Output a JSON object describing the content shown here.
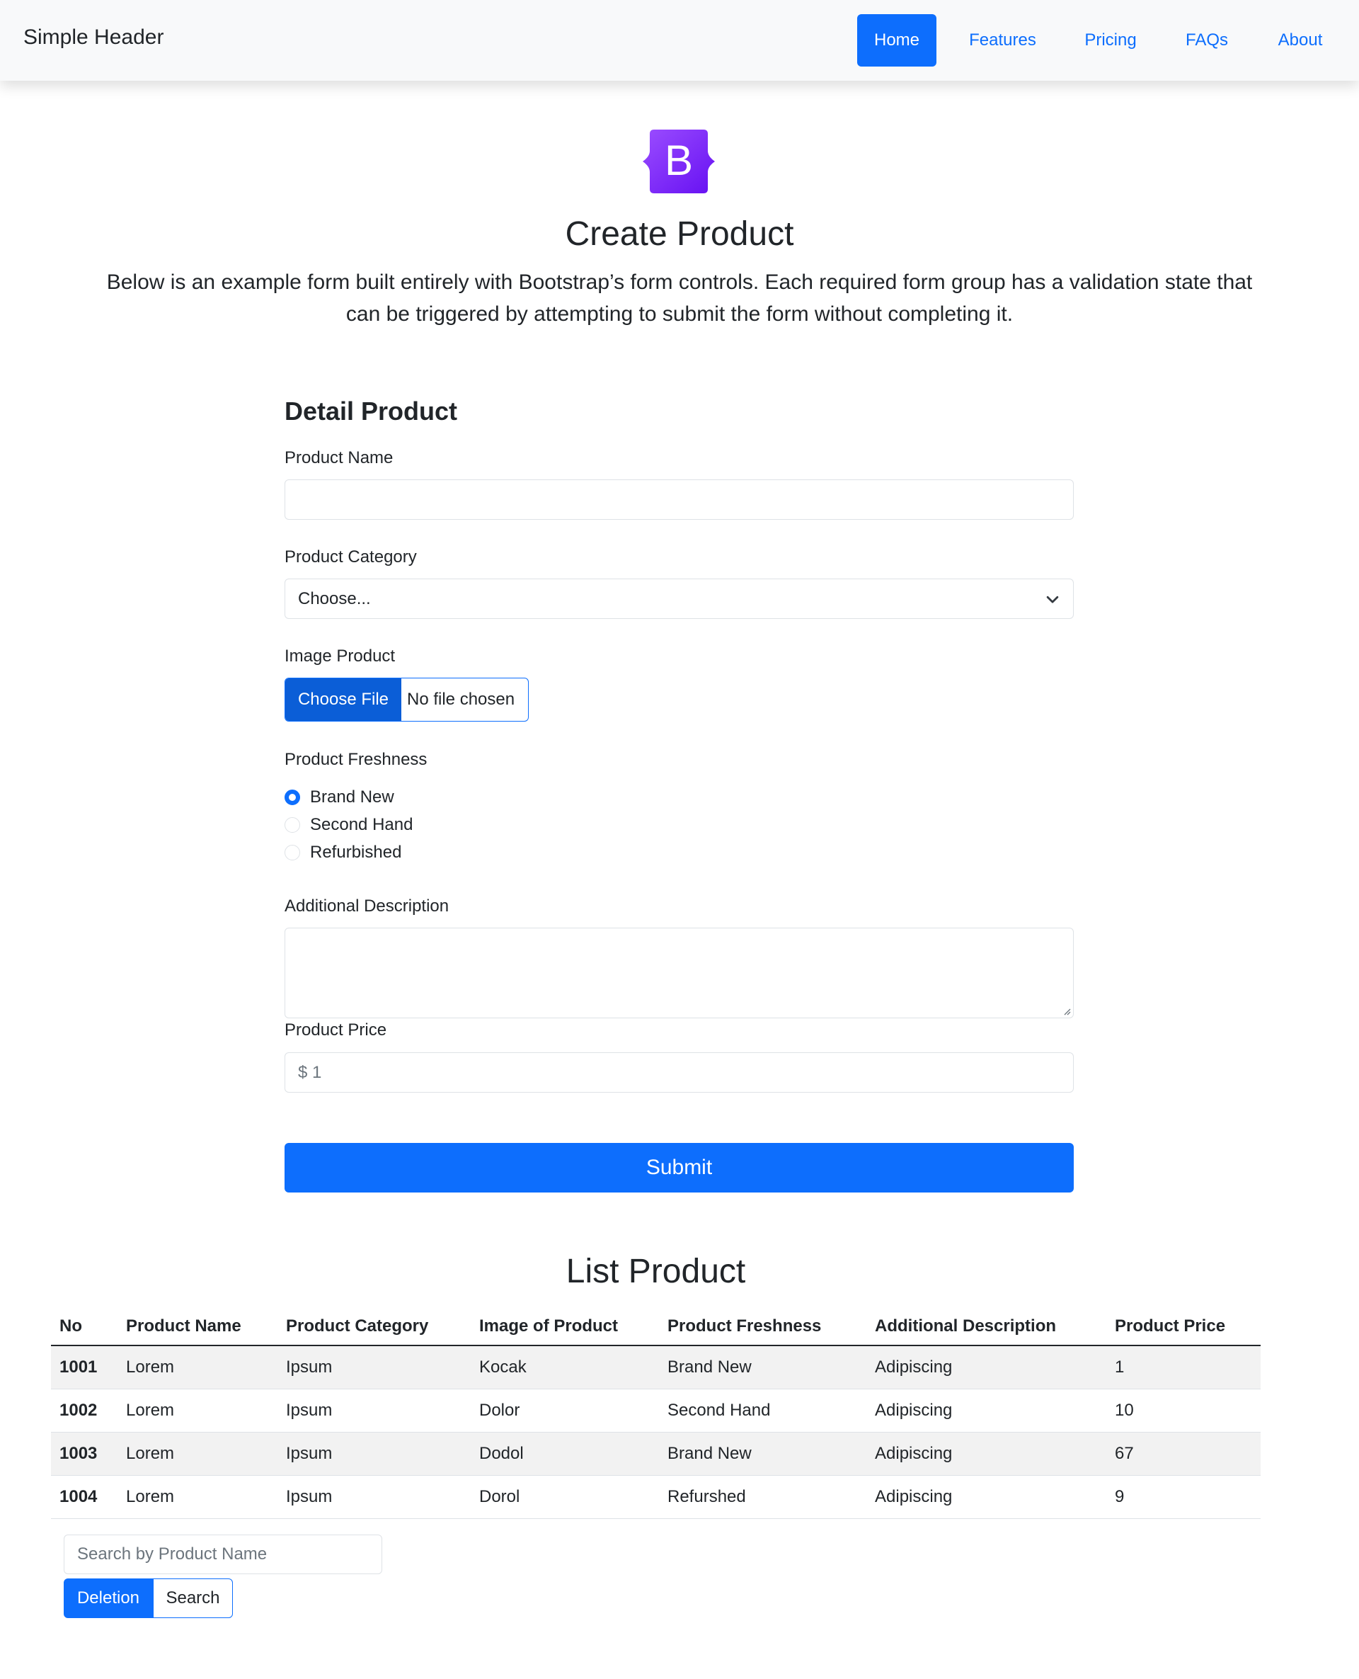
{
  "header": {
    "brand": "Simple Header",
    "nav": [
      {
        "label": "Home",
        "active": true
      },
      {
        "label": "Features"
      },
      {
        "label": "Pricing"
      },
      {
        "label": "FAQs"
      },
      {
        "label": "About"
      }
    ]
  },
  "logo": {
    "letter": "B",
    "colors": [
      "#712cf9",
      "#9b4dff"
    ]
  },
  "intro": {
    "title": "Create Product",
    "lead": "Below is an example form built entirely with Bootstrap’s form controls. Each required form group has a validation state that can be triggered by attempting to submit the form without completing it."
  },
  "form": {
    "section_title": "Detail Product",
    "product_name_label": "Product Name",
    "product_name_value": "",
    "category_label": "Product Category",
    "category_selected": "Choose...",
    "image_label": "Image Product",
    "file_button": "Choose File",
    "file_status": "No file chosen",
    "freshness_label": "Product Freshness",
    "freshness_options": [
      "Brand New",
      "Second Hand",
      "Refurbished"
    ],
    "freshness_selected": "Brand New",
    "description_label": "Additional Description",
    "price_label": "Product Price",
    "price_placeholder": "$ 1",
    "submit_label": "Submit"
  },
  "list": {
    "title": "List Product",
    "columns": [
      "No",
      "Product Name",
      "Product Category",
      "Image of Product",
      "Product Freshness",
      "Additional Description",
      "Product Price"
    ],
    "rows": [
      [
        "1001",
        "Lorem",
        "Ipsum",
        "Kocak",
        "Brand New",
        "Adipiscing",
        "1"
      ],
      [
        "1002",
        "Lorem",
        "Ipsum",
        "Dolor",
        "Second Hand",
        "Adipiscing",
        "10"
      ],
      [
        "1003",
        "Lorem",
        "Ipsum",
        "Dodol",
        "Brand New",
        "Adipiscing",
        "67"
      ],
      [
        "1004",
        "Lorem",
        "Ipsum",
        "Dorol",
        "Refurshed",
        "Adipiscing",
        "9"
      ]
    ],
    "search_placeholder": "Search by Product Name",
    "delete_label": "Deletion",
    "search_label": "Search"
  },
  "colors": {
    "primary": "#0d6efd",
    "file_button": "#0b5ed7",
    "stripe": "#f2f2f2"
  }
}
